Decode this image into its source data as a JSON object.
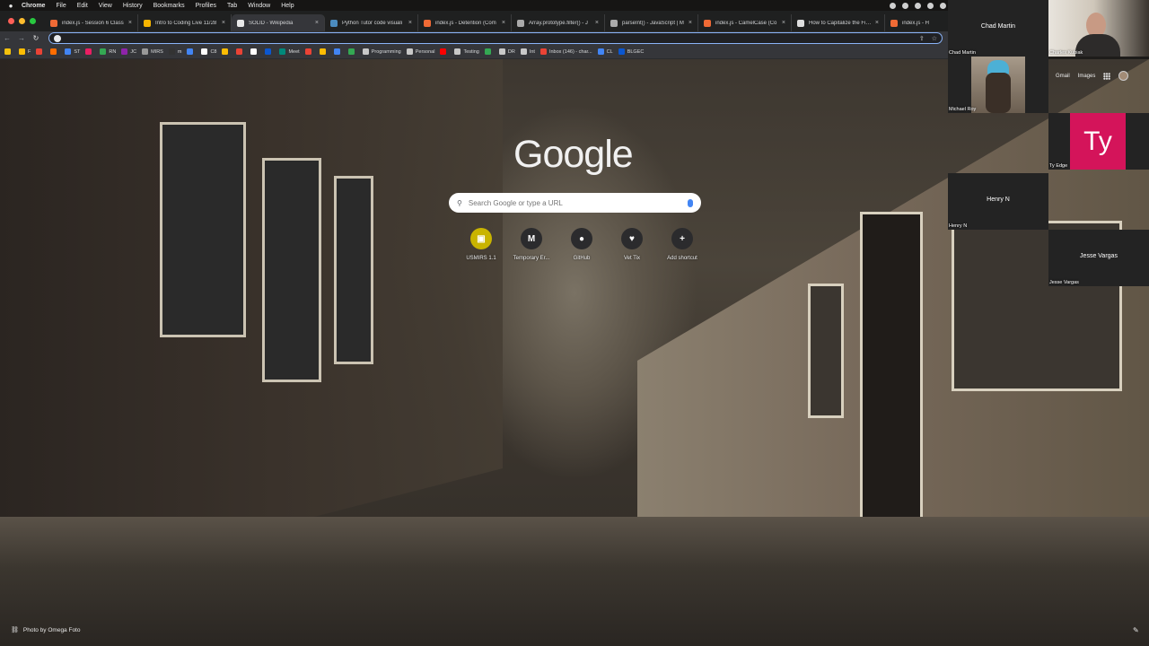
{
  "menubar": {
    "app": "Chrome",
    "items": [
      "File",
      "Edit",
      "View",
      "History",
      "Bookmarks",
      "Profiles",
      "Tab",
      "Window",
      "Help"
    ]
  },
  "tabs": [
    {
      "title": "index.js - Session 6 Class",
      "color": "#f06a35",
      "active": false
    },
    {
      "title": "Intro to Coding Live 11/28",
      "color": "#f6b400",
      "active": false
    },
    {
      "title": "SOLID - Wikipedia",
      "color": "#e8e8e8",
      "active": true
    },
    {
      "title": "Python Tutor code visuali",
      "color": "#4b8bbe",
      "active": false
    },
    {
      "title": "index.js - Detention (Com",
      "color": "#f06a35",
      "active": false
    },
    {
      "title": "Array.prototype.filter() - J",
      "color": "#aaaaaa",
      "active": false
    },
    {
      "title": "parseInt() - JavaScript | M",
      "color": "#aaaaaa",
      "active": false
    },
    {
      "title": "index.js - CamelCase (Co",
      "color": "#f06a35",
      "active": false
    },
    {
      "title": "How to Capitalize the First",
      "color": "#dddddd",
      "active": false
    },
    {
      "title": "index.js - H",
      "color": "#f06a35",
      "active": false
    }
  ],
  "omnibox": {
    "value": "",
    "placeholder": ""
  },
  "bookmarks": [
    {
      "label": "",
      "color": "#f4c20d"
    },
    {
      "label": "F",
      "color": "#fbbc04"
    },
    {
      "label": "",
      "color": "#ea4335"
    },
    {
      "label": "",
      "color": "#ff6d00"
    },
    {
      "label": "ST",
      "color": "#4285f4"
    },
    {
      "label": "",
      "color": "#e91e63"
    },
    {
      "label": "RN",
      "color": "#34a853"
    },
    {
      "label": "JC",
      "color": "#8e24aa"
    },
    {
      "label": "MIRS",
      "color": "#999999"
    },
    {
      "label": "m",
      "color": "#333333"
    },
    {
      "label": "",
      "color": "#4285f4"
    },
    {
      "label": "C8",
      "color": "#ffffff"
    },
    {
      "label": "",
      "color": "#fbbc04"
    },
    {
      "label": "",
      "color": "#ea4335"
    },
    {
      "label": "",
      "color": "#ffffff"
    },
    {
      "label": "",
      "color": "#0b57d0"
    },
    {
      "label": "Meet",
      "color": "#00897b"
    },
    {
      "label": "",
      "color": "#ea4335"
    },
    {
      "label": "",
      "color": "#fbbc04"
    },
    {
      "label": "",
      "color": "#4285f4"
    },
    {
      "label": "",
      "color": "#34a853"
    },
    {
      "label": "Programming",
      "color": "#c8c8c8"
    },
    {
      "label": "Personal",
      "color": "#c8c8c8"
    },
    {
      "label": "",
      "color": "#ff0000"
    },
    {
      "label": "Testing",
      "color": "#c8c8c8"
    },
    {
      "label": "",
      "color": "#34a853"
    },
    {
      "label": "DR",
      "color": "#c8c8c8"
    },
    {
      "label": "Int",
      "color": "#c8c8c8"
    },
    {
      "label": "Inbox (146) - char...",
      "color": "#ea4335"
    },
    {
      "label": "CL",
      "color": "#4285f4"
    },
    {
      "label": "BLGEC",
      "color": "#0b57d0"
    }
  ],
  "ntp": {
    "logo": "Google",
    "search_placeholder": "Search Google or type a URL",
    "shortcuts": [
      {
        "label": "USMIRS 1.1",
        "icon": "usmirs-icon",
        "glyph": "▣",
        "bg": "#c9b400"
      },
      {
        "label": "Temporary Er...",
        "icon": "gmail-icon",
        "glyph": "M",
        "bg": "#2b2b2d"
      },
      {
        "label": "GitHub",
        "icon": "github-icon",
        "glyph": "●",
        "bg": "#2b2b2d"
      },
      {
        "label": "Vet Tix",
        "icon": "vettix-icon",
        "glyph": "♥",
        "bg": "#2b2b2d"
      },
      {
        "label": "Add shortcut",
        "icon": "plus-icon",
        "glyph": "+",
        "bg": "#2b2b2d"
      }
    ],
    "gmail": "Gmail",
    "images": "Images",
    "photo_credit": "Photo by Omega Foto"
  },
  "participants": [
    {
      "name": "Chad Martin",
      "center": "Chad Martin"
    },
    {
      "name": "Charles Kubiak",
      "center": ""
    },
    {
      "name": "Michael Roy",
      "center": ""
    },
    {
      "name": "Ty Edge",
      "center": "",
      "initials": "Ty"
    },
    {
      "name": "Henry N",
      "center": "Henry N"
    },
    {
      "name": "Jesse Vargas",
      "center": "Jesse Vargas"
    }
  ]
}
